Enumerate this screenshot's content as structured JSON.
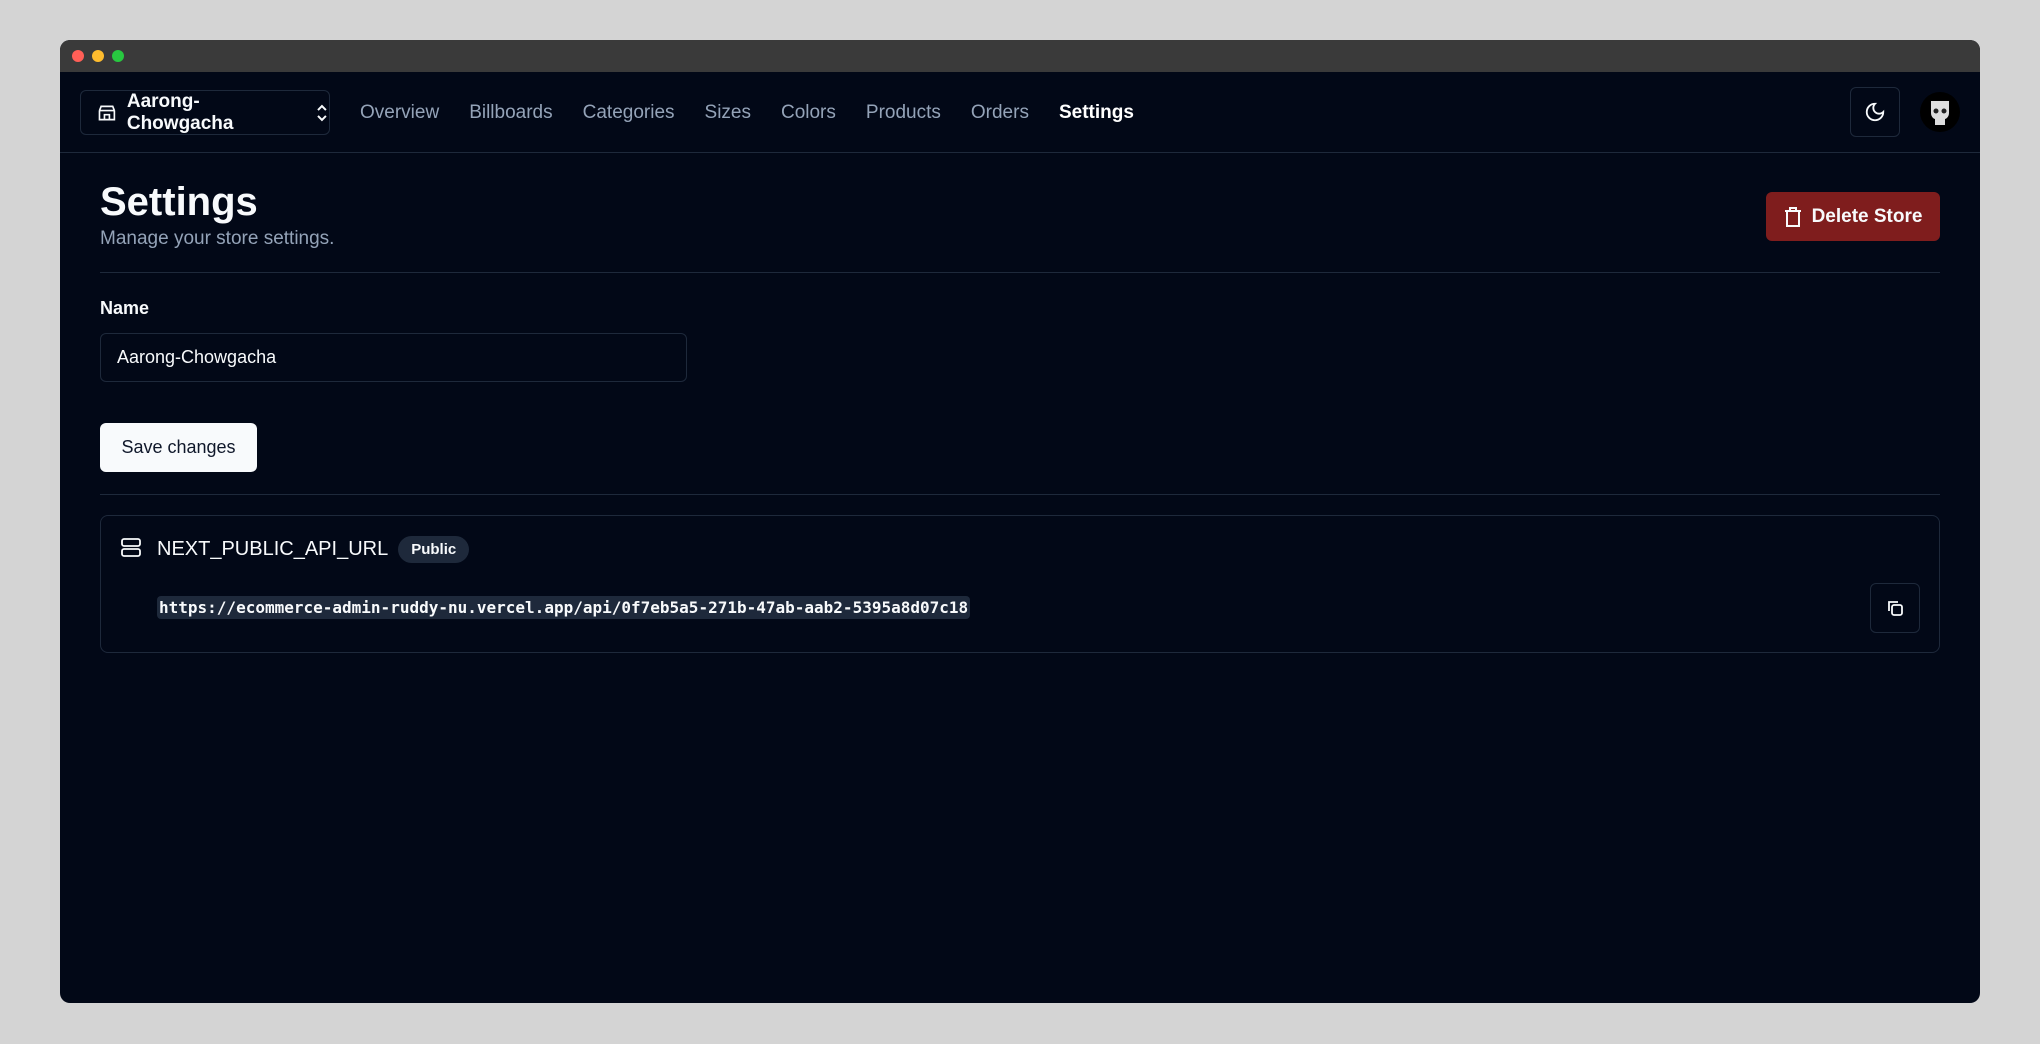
{
  "window": {
    "dots": [
      "#ff5f57",
      "#febc2e",
      "#28c840"
    ]
  },
  "nav": {
    "store": "Aarong-Chowgacha",
    "links": [
      "Overview",
      "Billboards",
      "Categories",
      "Sizes",
      "Colors",
      "Products",
      "Orders",
      "Settings"
    ],
    "active": "Settings"
  },
  "page": {
    "title": "Settings",
    "subtitle": "Manage your store settings.",
    "delete_label": "Delete Store"
  },
  "form": {
    "name_label": "Name",
    "name_value": "Aarong-Chowgacha",
    "save_label": "Save changes"
  },
  "api": {
    "title": "NEXT_PUBLIC_API_URL",
    "badge": "Public",
    "url": "https://ecommerce-admin-ruddy-nu.vercel.app/api/0f7eb5a5-271b-47ab-aab2-5395a8d07c18"
  },
  "colors": {
    "background": "#020817",
    "border": "#1e293b",
    "danger": "#7f1d1d"
  }
}
